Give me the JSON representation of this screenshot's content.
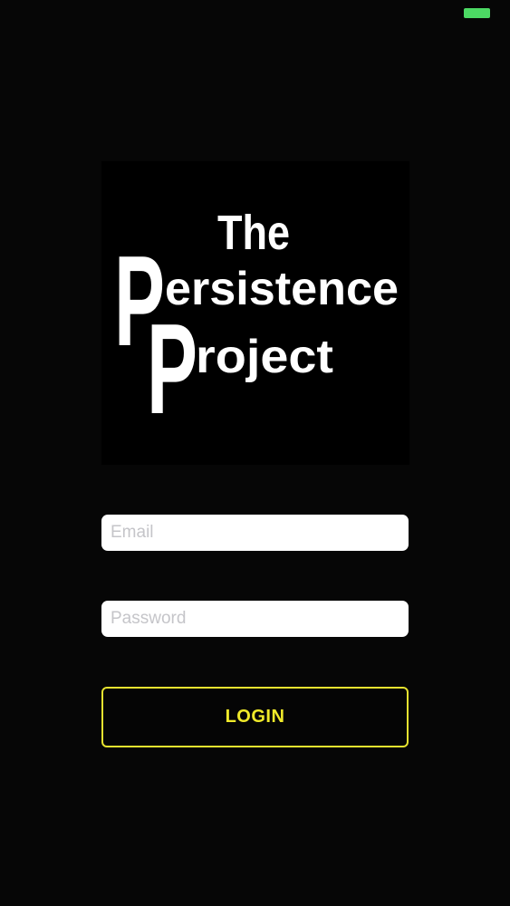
{
  "status_bar": {
    "battery_color": "#4cd964"
  },
  "logo": {
    "line1": "The",
    "line2_initial": "P",
    "line2_rest": "ersistence",
    "line3_rest": "roject"
  },
  "form": {
    "email_placeholder": "Email",
    "password_placeholder": "Password",
    "login_label": "LOGIN",
    "accent_color": "#e6e22f"
  }
}
